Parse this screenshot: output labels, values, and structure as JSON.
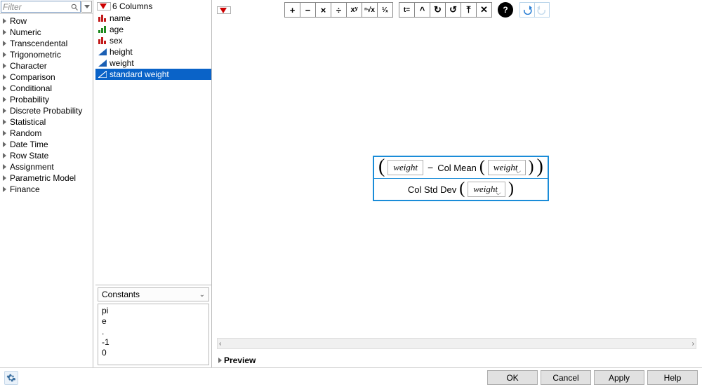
{
  "filter": {
    "placeholder": "Filter"
  },
  "categories": [
    "Row",
    "Numeric",
    "Transcendental",
    "Trigonometric",
    "Character",
    "Comparison",
    "Conditional",
    "Probability",
    "Discrete Probability",
    "Statistical",
    "Random",
    "Date Time",
    "Row State",
    "Assignment",
    "Parametric Model",
    "Finance"
  ],
  "columnsHeader": "6 Columns",
  "columns": [
    {
      "name": "name",
      "icon": "histo-red",
      "selected": false
    },
    {
      "name": "age",
      "icon": "histo-green",
      "selected": false
    },
    {
      "name": "sex",
      "icon": "histo-red",
      "selected": false
    },
    {
      "name": "height",
      "icon": "tri-blue",
      "selected": false
    },
    {
      "name": "weight",
      "icon": "tri-blue",
      "selected": false
    },
    {
      "name": "standard weight",
      "icon": "tri-blue-out",
      "selected": true
    }
  ],
  "constants": {
    "label": "Constants",
    "items": [
      "pi",
      "e",
      ".",
      "-1",
      "0"
    ]
  },
  "toolbar": {
    "ops1": [
      "+",
      "−",
      "×",
      "÷",
      "xʸ",
      "ⁿ√x",
      "¹⁄ₓ"
    ],
    "ops2": [
      "t=",
      "^",
      "↻",
      "↺",
      "⤒",
      "✕"
    ]
  },
  "formula": {
    "var1": "weight",
    "minus": "−",
    "func1": "Col Mean",
    "arg1": "weight",
    "func2": "Col Std Dev",
    "arg2": "weight"
  },
  "preview": "Preview",
  "buttons": {
    "ok": "OK",
    "cancel": "Cancel",
    "apply": "Apply",
    "help": "Help"
  }
}
